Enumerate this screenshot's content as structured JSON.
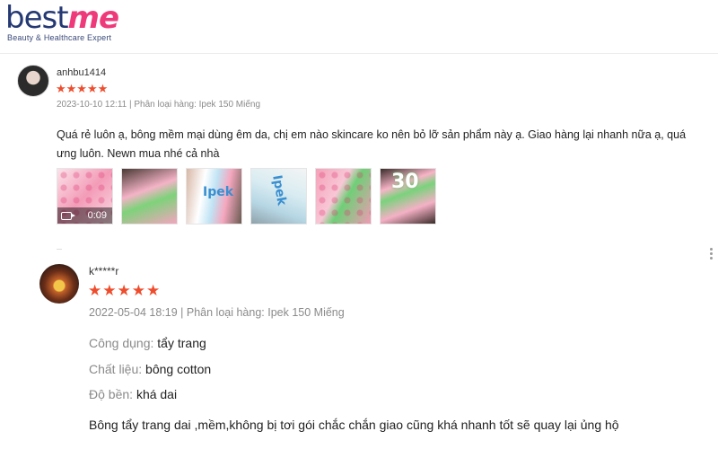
{
  "brand": {
    "logo_part1": "best",
    "logo_part2": "me",
    "tagline": "Beauty & Healthcare Expert",
    "colors": {
      "navy": "#243873",
      "pink": "#ee3a7a"
    }
  },
  "reviews": [
    {
      "username": "anhbu1414",
      "rating": 5,
      "stars": "★★★★★",
      "meta": "2023-10-10 12:11 | Phân loại hàng: Ipek 150 Miếng",
      "text": "Quá rẻ luôn ạ, bông mềm mại dùng êm da, chị em nào skincare ko nên bỏ lỡ sản phẩm này ạ. Giao hàng lại nhanh nữa ạ, quá ưng luôn. Newn mua nhé cả nhà",
      "media": [
        {
          "type": "video",
          "duration": "0:09"
        },
        {
          "type": "image"
        },
        {
          "type": "image",
          "caption": "Ipek"
        },
        {
          "type": "image",
          "caption": "Ipek"
        },
        {
          "type": "image"
        },
        {
          "type": "image",
          "caption": "30"
        }
      ]
    },
    {
      "username": "k*****r",
      "rating": 5,
      "stars": "★★★★★",
      "meta": "2022-05-04 18:19 | Phân loại hàng: Ipek 150 Miếng",
      "attributes": [
        {
          "label": "Công dụng:",
          "value": "tẩy trang"
        },
        {
          "label": "Chất liệu:",
          "value": "bông cotton"
        },
        {
          "label": "Độ bền:",
          "value": "khá dai"
        }
      ],
      "text": "Bông tẩy trang dai ,mềm,không bị tơi gói chắc chắn giao cũng khá nhanh tốt sẽ quay lại ủng hộ"
    }
  ],
  "accent_star_color": "#ee4d2d"
}
